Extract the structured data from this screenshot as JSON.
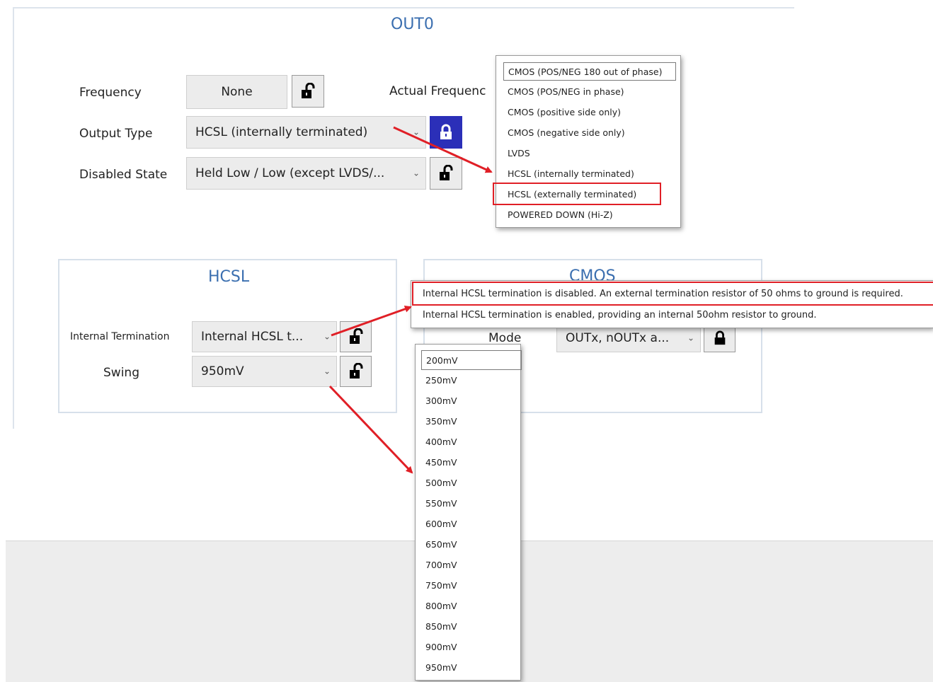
{
  "out0": {
    "title": "OUT0",
    "frequency_label": "Frequency",
    "frequency_value": "None",
    "actual_frequency_label": "Actual Frequenc",
    "output_type_label": "Output Type",
    "output_type_value": "HCSL (internally terminated)",
    "disabled_state_label": "Disabled State",
    "disabled_state_value": "Held Low / Low (except LVDS/..."
  },
  "hcsl": {
    "title": "HCSL",
    "internal_termination_label": "Internal Termination",
    "internal_termination_value": "Internal HCSL t...",
    "swing_label": "Swing",
    "swing_value": "950mV"
  },
  "cmos": {
    "title": "CMOS",
    "mode_label": "Mode",
    "mode_value": "OUTx, nOUTx a..."
  },
  "output_type_dropdown": {
    "options": [
      "CMOS (POS/NEG 180 out of phase)",
      "CMOS (POS/NEG in phase)",
      "CMOS (positive side only)",
      "CMOS (negative side only)",
      "LVDS",
      "HCSL (internally terminated)",
      "HCSL (externally terminated)",
      "POWERED DOWN (Hi-Z)"
    ],
    "selected_index": 0,
    "highlighted_index": 6
  },
  "termination_dropdown": {
    "options": [
      "Internal HCSL termination is disabled. An external termination resistor of 50 ohms to ground is required.",
      "Internal HCSL termination is enabled, providing an internal 50ohm resistor to ground."
    ],
    "highlighted_index": 0
  },
  "swing_dropdown": {
    "options": [
      "200mV",
      "250mV",
      "300mV",
      "350mV",
      "400mV",
      "450mV",
      "500mV",
      "550mV",
      "600mV",
      "650mV",
      "700mV",
      "750mV",
      "800mV",
      "850mV",
      "900mV",
      "950mV"
    ],
    "selected_index": 0
  },
  "colors": {
    "title_blue": "#3b6fb0",
    "lock_active": "#2b2fb8",
    "annotation_red": "#e01f26"
  }
}
